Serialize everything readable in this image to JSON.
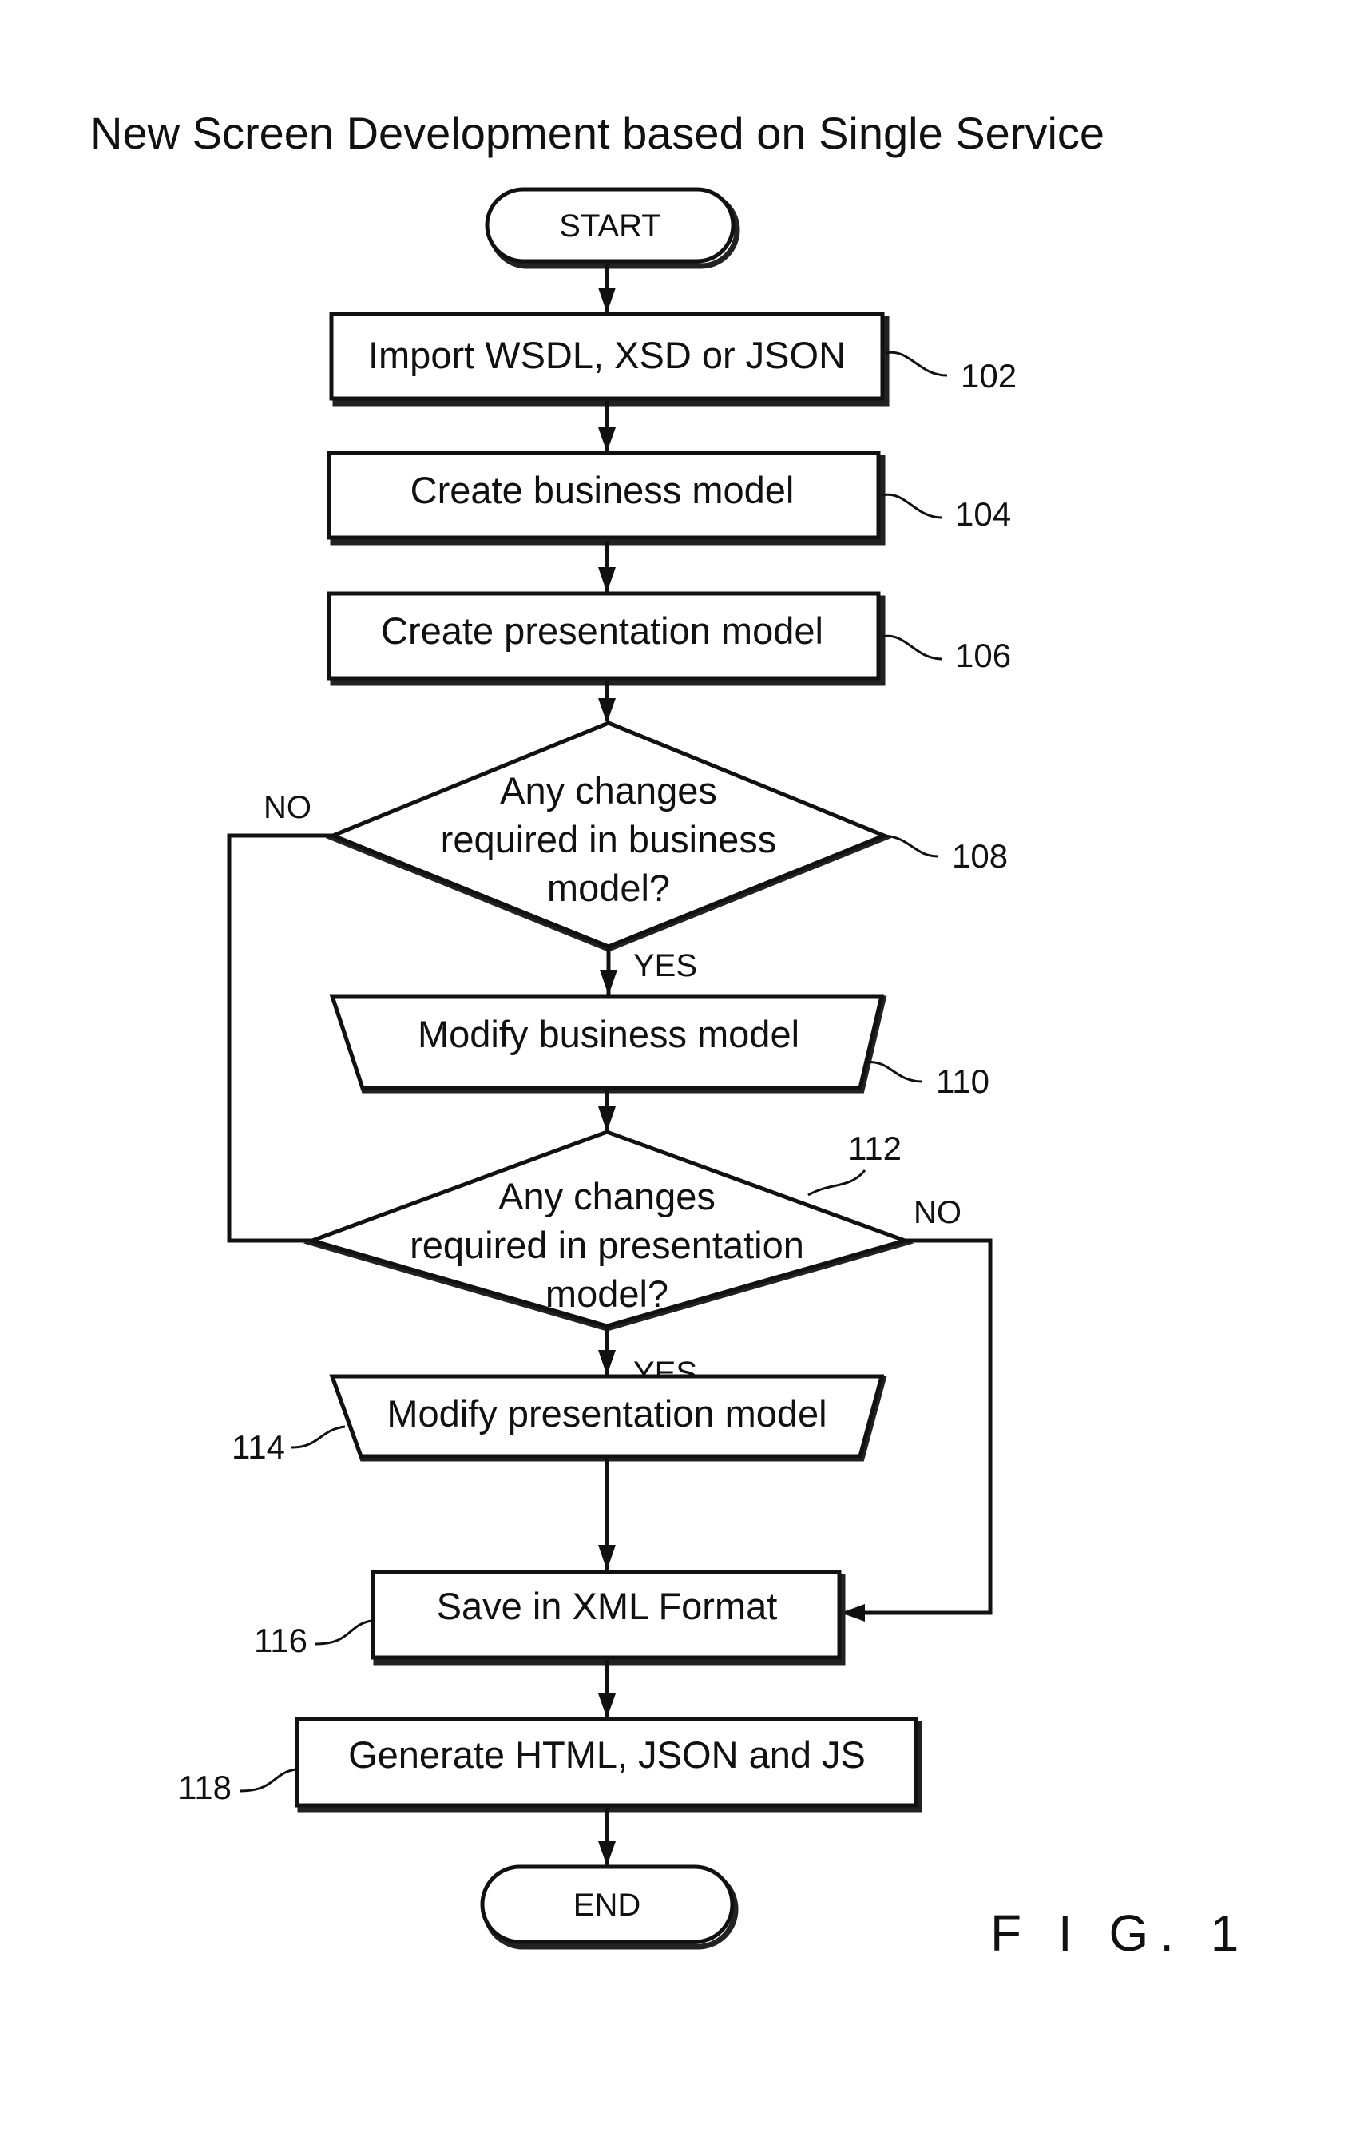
{
  "title": "New Screen Development based on Single Service",
  "figure_label": "F I G. 1",
  "terminals": {
    "start": "START",
    "end": "END"
  },
  "steps": {
    "s102": {
      "ref": "102",
      "lines": [
        "Import WSDL, XSD or JSON"
      ]
    },
    "s104": {
      "ref": "104",
      "lines": [
        "Create business model"
      ]
    },
    "s106": {
      "ref": "106",
      "lines": [
        "Create presentation model"
      ]
    },
    "s108": {
      "ref": "108",
      "lines": [
        "Any changes",
        "required in business",
        "model?"
      ]
    },
    "s110": {
      "ref": "110",
      "lines": [
        "Modify business model"
      ]
    },
    "s112": {
      "ref": "112",
      "lines": [
        "Any changes",
        "required in presentation",
        "model?"
      ]
    },
    "s114": {
      "ref": "114",
      "lines": [
        "Modify presentation model"
      ]
    },
    "s116": {
      "ref": "116",
      "lines": [
        "Save in XML Format"
      ]
    },
    "s118": {
      "ref": "118",
      "lines": [
        "Generate HTML, JSON and JS"
      ]
    }
  },
  "branches": {
    "b108_no": "NO",
    "b108_yes": "YES",
    "b112_no": "NO",
    "b112_yes": "YES"
  }
}
